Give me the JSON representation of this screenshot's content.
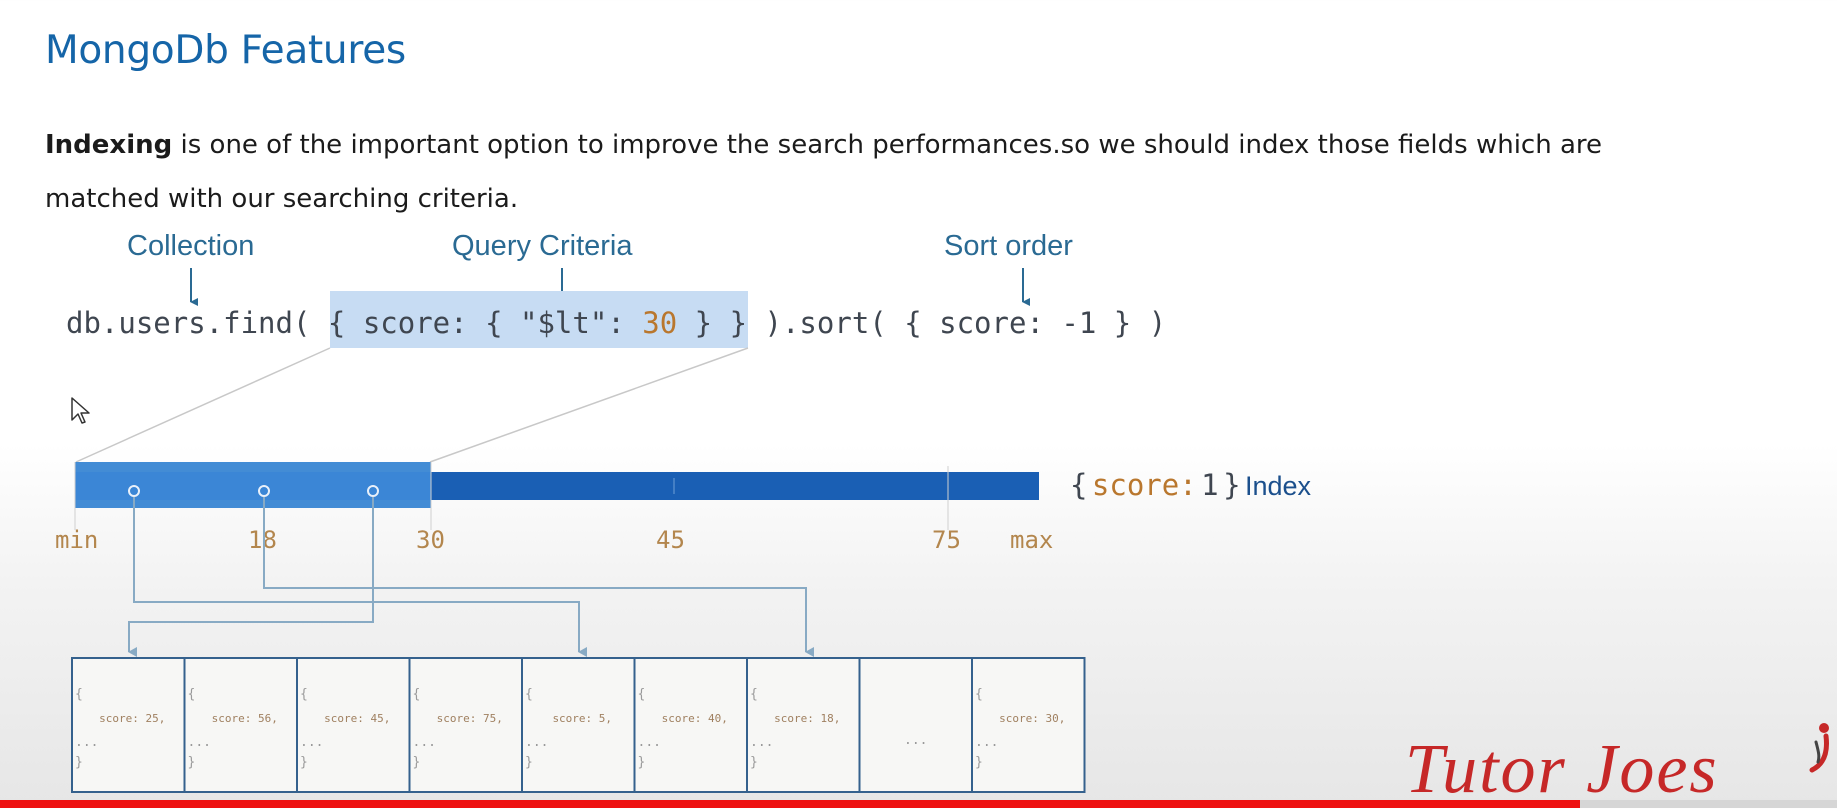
{
  "slide": {
    "title": "MongoDb Features",
    "description_bold": "Indexing",
    "description_rest": " is one of the important option to improve the search performances.so we should index those fields which are matched with our searching criteria."
  },
  "callouts": {
    "collection": "Collection",
    "query_criteria": "Query Criteria",
    "sort_order": "Sort order"
  },
  "query": {
    "part1": "db.users.find(",
    "open_brace": "{",
    "field1": "score:",
    "inner_open": "{",
    "op": "\"$lt\":",
    "op_value": "30",
    "inner_close": "}",
    "close_brace": "}",
    "part2": ").sort(",
    "sort_open": "{",
    "sort_field": "score:",
    "sort_value": "-1",
    "sort_close": "}",
    "end": ")"
  },
  "index": {
    "label_open": "{",
    "label_field": "score:",
    "label_value": "1",
    "label_close": "}",
    "label_word": "Index",
    "ticks": [
      "min",
      "18",
      "30",
      "45",
      "75",
      "max"
    ]
  },
  "documents": [
    {
      "text": "score: 25,"
    },
    {
      "text": "score: 56,"
    },
    {
      "text": "score: 45,"
    },
    {
      "text": "score: 75,"
    },
    {
      "text": "score: 5,"
    },
    {
      "text": "score: 40,"
    },
    {
      "text": "score: 18,"
    },
    {
      "text": "..."
    },
    {
      "text": "score: 30,"
    }
  ],
  "doc_braces": {
    "open": "{",
    "dots": "...",
    "close": "}"
  },
  "watermark": "Tutor Joes",
  "video": {
    "progress_percent": 86
  },
  "colors": {
    "title": "#1565a8",
    "highlight": "#c7dcf3",
    "index_bar": "#1a5fb4",
    "index_highlight": "#2f7fd0",
    "watermark": "#c62828",
    "progress": "#ee1111"
  },
  "icons": {
    "cursor": "mouse-pointer-icon",
    "logo": "tutor-joes-logo-icon"
  }
}
